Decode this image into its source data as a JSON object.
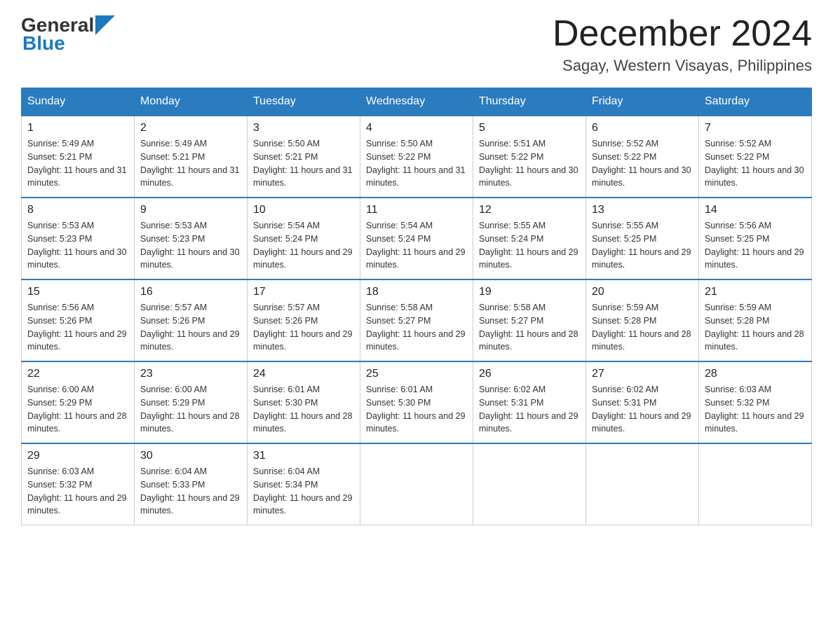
{
  "header": {
    "logo_general": "General",
    "logo_blue": "Blue",
    "month_year": "December 2024",
    "location": "Sagay, Western Visayas, Philippines"
  },
  "columns": [
    "Sunday",
    "Monday",
    "Tuesday",
    "Wednesday",
    "Thursday",
    "Friday",
    "Saturday"
  ],
  "weeks": [
    [
      {
        "day": "1",
        "sunrise": "Sunrise: 5:49 AM",
        "sunset": "Sunset: 5:21 PM",
        "daylight": "Daylight: 11 hours and 31 minutes."
      },
      {
        "day": "2",
        "sunrise": "Sunrise: 5:49 AM",
        "sunset": "Sunset: 5:21 PM",
        "daylight": "Daylight: 11 hours and 31 minutes."
      },
      {
        "day": "3",
        "sunrise": "Sunrise: 5:50 AM",
        "sunset": "Sunset: 5:21 PM",
        "daylight": "Daylight: 11 hours and 31 minutes."
      },
      {
        "day": "4",
        "sunrise": "Sunrise: 5:50 AM",
        "sunset": "Sunset: 5:22 PM",
        "daylight": "Daylight: 11 hours and 31 minutes."
      },
      {
        "day": "5",
        "sunrise": "Sunrise: 5:51 AM",
        "sunset": "Sunset: 5:22 PM",
        "daylight": "Daylight: 11 hours and 30 minutes."
      },
      {
        "day": "6",
        "sunrise": "Sunrise: 5:52 AM",
        "sunset": "Sunset: 5:22 PM",
        "daylight": "Daylight: 11 hours and 30 minutes."
      },
      {
        "day": "7",
        "sunrise": "Sunrise: 5:52 AM",
        "sunset": "Sunset: 5:22 PM",
        "daylight": "Daylight: 11 hours and 30 minutes."
      }
    ],
    [
      {
        "day": "8",
        "sunrise": "Sunrise: 5:53 AM",
        "sunset": "Sunset: 5:23 PM",
        "daylight": "Daylight: 11 hours and 30 minutes."
      },
      {
        "day": "9",
        "sunrise": "Sunrise: 5:53 AM",
        "sunset": "Sunset: 5:23 PM",
        "daylight": "Daylight: 11 hours and 30 minutes."
      },
      {
        "day": "10",
        "sunrise": "Sunrise: 5:54 AM",
        "sunset": "Sunset: 5:24 PM",
        "daylight": "Daylight: 11 hours and 29 minutes."
      },
      {
        "day": "11",
        "sunrise": "Sunrise: 5:54 AM",
        "sunset": "Sunset: 5:24 PM",
        "daylight": "Daylight: 11 hours and 29 minutes."
      },
      {
        "day": "12",
        "sunrise": "Sunrise: 5:55 AM",
        "sunset": "Sunset: 5:24 PM",
        "daylight": "Daylight: 11 hours and 29 minutes."
      },
      {
        "day": "13",
        "sunrise": "Sunrise: 5:55 AM",
        "sunset": "Sunset: 5:25 PM",
        "daylight": "Daylight: 11 hours and 29 minutes."
      },
      {
        "day": "14",
        "sunrise": "Sunrise: 5:56 AM",
        "sunset": "Sunset: 5:25 PM",
        "daylight": "Daylight: 11 hours and 29 minutes."
      }
    ],
    [
      {
        "day": "15",
        "sunrise": "Sunrise: 5:56 AM",
        "sunset": "Sunset: 5:26 PM",
        "daylight": "Daylight: 11 hours and 29 minutes."
      },
      {
        "day": "16",
        "sunrise": "Sunrise: 5:57 AM",
        "sunset": "Sunset: 5:26 PM",
        "daylight": "Daylight: 11 hours and 29 minutes."
      },
      {
        "day": "17",
        "sunrise": "Sunrise: 5:57 AM",
        "sunset": "Sunset: 5:26 PM",
        "daylight": "Daylight: 11 hours and 29 minutes."
      },
      {
        "day": "18",
        "sunrise": "Sunrise: 5:58 AM",
        "sunset": "Sunset: 5:27 PM",
        "daylight": "Daylight: 11 hours and 29 minutes."
      },
      {
        "day": "19",
        "sunrise": "Sunrise: 5:58 AM",
        "sunset": "Sunset: 5:27 PM",
        "daylight": "Daylight: 11 hours and 28 minutes."
      },
      {
        "day": "20",
        "sunrise": "Sunrise: 5:59 AM",
        "sunset": "Sunset: 5:28 PM",
        "daylight": "Daylight: 11 hours and 28 minutes."
      },
      {
        "day": "21",
        "sunrise": "Sunrise: 5:59 AM",
        "sunset": "Sunset: 5:28 PM",
        "daylight": "Daylight: 11 hours and 28 minutes."
      }
    ],
    [
      {
        "day": "22",
        "sunrise": "Sunrise: 6:00 AM",
        "sunset": "Sunset: 5:29 PM",
        "daylight": "Daylight: 11 hours and 28 minutes."
      },
      {
        "day": "23",
        "sunrise": "Sunrise: 6:00 AM",
        "sunset": "Sunset: 5:29 PM",
        "daylight": "Daylight: 11 hours and 28 minutes."
      },
      {
        "day": "24",
        "sunrise": "Sunrise: 6:01 AM",
        "sunset": "Sunset: 5:30 PM",
        "daylight": "Daylight: 11 hours and 28 minutes."
      },
      {
        "day": "25",
        "sunrise": "Sunrise: 6:01 AM",
        "sunset": "Sunset: 5:30 PM",
        "daylight": "Daylight: 11 hours and 29 minutes."
      },
      {
        "day": "26",
        "sunrise": "Sunrise: 6:02 AM",
        "sunset": "Sunset: 5:31 PM",
        "daylight": "Daylight: 11 hours and 29 minutes."
      },
      {
        "day": "27",
        "sunrise": "Sunrise: 6:02 AM",
        "sunset": "Sunset: 5:31 PM",
        "daylight": "Daylight: 11 hours and 29 minutes."
      },
      {
        "day": "28",
        "sunrise": "Sunrise: 6:03 AM",
        "sunset": "Sunset: 5:32 PM",
        "daylight": "Daylight: 11 hours and 29 minutes."
      }
    ],
    [
      {
        "day": "29",
        "sunrise": "Sunrise: 6:03 AM",
        "sunset": "Sunset: 5:32 PM",
        "daylight": "Daylight: 11 hours and 29 minutes."
      },
      {
        "day": "30",
        "sunrise": "Sunrise: 6:04 AM",
        "sunset": "Sunset: 5:33 PM",
        "daylight": "Daylight: 11 hours and 29 minutes."
      },
      {
        "day": "31",
        "sunrise": "Sunrise: 6:04 AM",
        "sunset": "Sunset: 5:34 PM",
        "daylight": "Daylight: 11 hours and 29 minutes."
      },
      null,
      null,
      null,
      null
    ]
  ]
}
